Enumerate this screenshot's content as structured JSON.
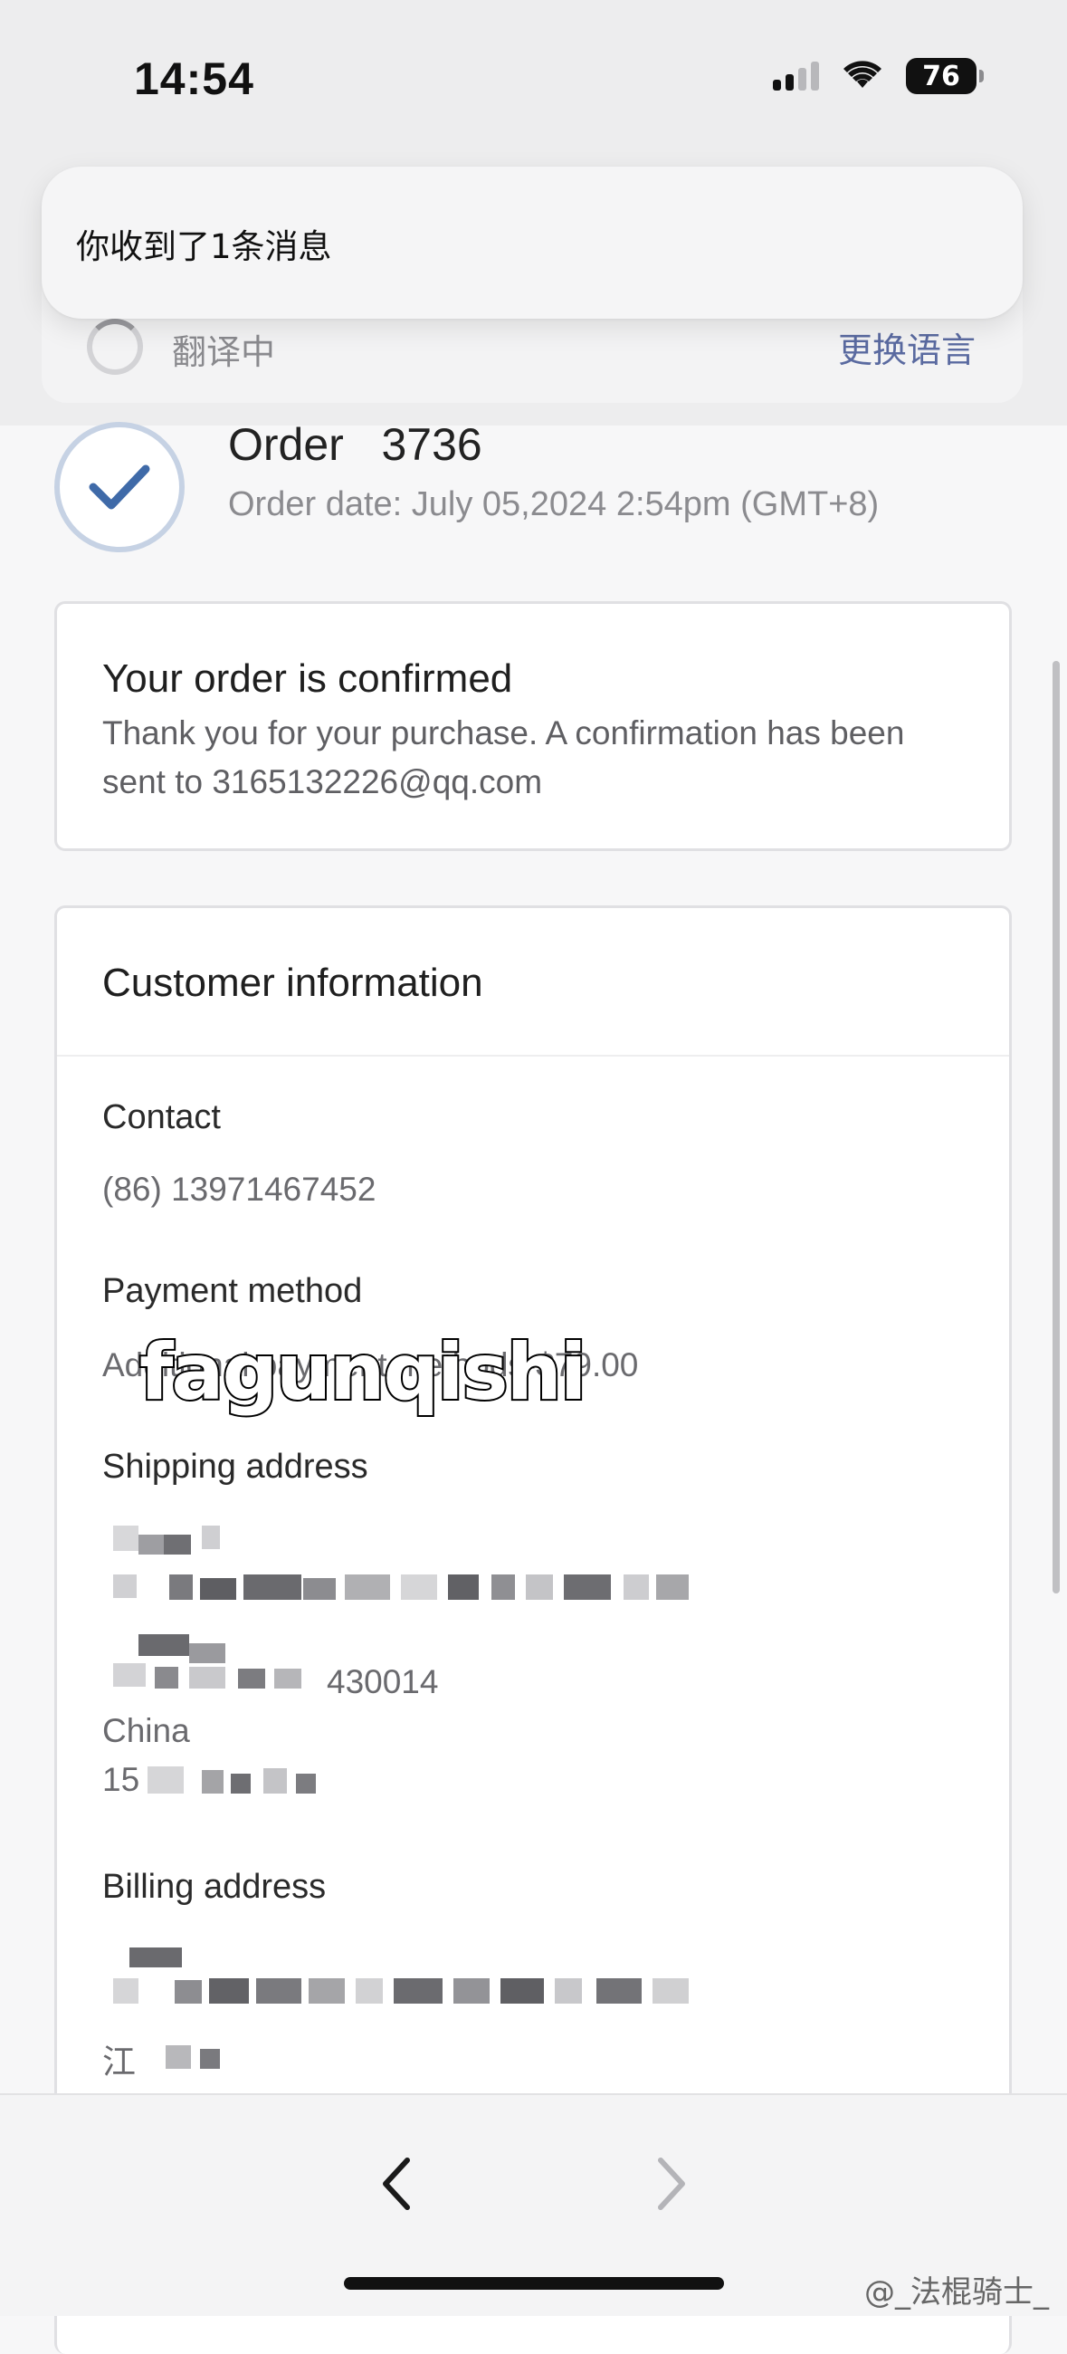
{
  "status_bar": {
    "time": "14:54",
    "battery": "76"
  },
  "notification": {
    "text": "你收到了1条消息"
  },
  "translate_bar": {
    "status": "翻译中",
    "change_language": "更换语言"
  },
  "order": {
    "title": "Order   3736",
    "date": "Order date:  July 05,2024 2:54pm (GMT+8)"
  },
  "confirmation": {
    "title": "Your order is confirmed",
    "message": "Thank you for your purchase. A confirmation has been sent to 3165132226@qq.com"
  },
  "customer": {
    "title": "Customer information",
    "contact_label": "Contact",
    "contact_value": "(86) 13971467452",
    "payment_label": "Payment method",
    "payment_value": "Additional payment methods-$79.00",
    "shipping_label": "Shipping address",
    "shipping_fragment_zip": "430014",
    "shipping_country": "China",
    "shipping_phone_prefix": "15",
    "billing_label": "Billing address",
    "billing_fragment_province": "江"
  },
  "overlay": {
    "watermark": "fagunqishi",
    "credit": "@_法棍骑士_"
  },
  "colors": {
    "accent_link": "#5a6aa0",
    "check": "#3f6aa8"
  }
}
